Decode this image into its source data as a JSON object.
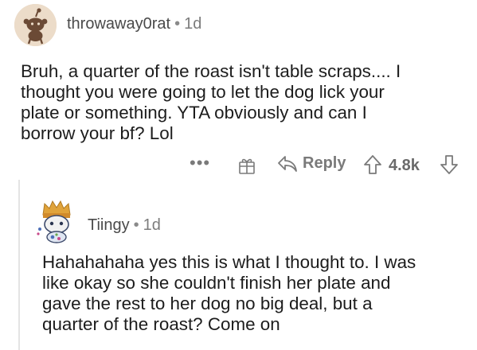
{
  "comment": {
    "username": "throwaway0rat",
    "separator": "•",
    "age": "1d",
    "lines": [
      "Bruh, a quarter of the roast isn't table scraps.... I",
      "thought you were going to let the dog lick your",
      "plate or something.  YTA obviously and can I",
      "borrow your bf? Lol"
    ],
    "avatar_icon": "snoo-avatar-icon"
  },
  "actions": {
    "more_label": "•••",
    "gift_icon": "gift-icon",
    "reply_icon": "reply-arrow-icon",
    "reply_label": "Reply",
    "upvote_icon": "upvote-arrow-icon",
    "score": "4.8k",
    "downvote_icon": "downvote-arrow-icon"
  },
  "reply": {
    "username": "Tiingy",
    "separator": "•",
    "age": "1d",
    "lines": [
      "Hahahahaha yes this is what I thought to. I was",
      "like okay so she couldn't finish her plate and",
      "gave the rest to her dog no big deal, but a",
      "quarter of the roast? Come on"
    ],
    "avatar_icon": "custom-avatar-icon"
  },
  "colors": {
    "meta_text": "#7c7c7c",
    "body_text": "#1c1c1c",
    "action_gray": "#7a7a7a",
    "thread_line": "#e4e4e4"
  }
}
